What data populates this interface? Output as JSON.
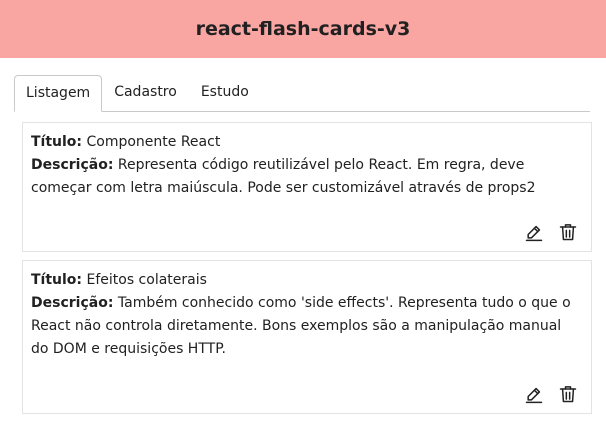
{
  "app": {
    "title": "react-flash-cards-v3"
  },
  "tabs": [
    {
      "label": "Listagem",
      "active": true
    },
    {
      "label": "Cadastro",
      "active": false
    },
    {
      "label": "Estudo",
      "active": false
    }
  ],
  "labels": {
    "title": "Título:",
    "description": "Descrição:"
  },
  "cards": [
    {
      "title": "Componente React",
      "description": "Representa código reutilizável pelo React. Em regra, deve começar com letra maiúscula. Pode ser customizável através de props2"
    },
    {
      "title": "Efeitos colaterais",
      "description": "Também conhecido como 'side effects'. Representa tudo o que o React não controla diretamente. Bons exemplos são a manipulação manual do DOM e requisições HTTP."
    }
  ],
  "icons": {
    "edit": "pencil-icon",
    "delete": "trash-icon"
  },
  "colors": {
    "header_bg": "#f9a5a2"
  }
}
